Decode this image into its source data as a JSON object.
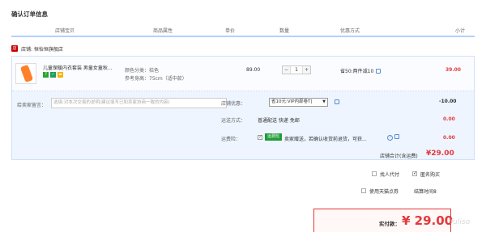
{
  "page": {
    "title": "确认订单信息"
  },
  "columns": [
    "店铺宝贝",
    "商品属性",
    "单价",
    "数量",
    "优惠方式",
    "小计"
  ],
  "shop": {
    "label": "店铺: 恒怡恒旗舰店"
  },
  "item": {
    "title": "儿童保暖内衣套装 男童女童秋...",
    "color": "颜色分类：桔色",
    "height": "参考身高：75cm（适中款）",
    "price": "89.00",
    "quantity": "1",
    "promo": "省50:两件减10",
    "subtotal": "39.00"
  },
  "message": {
    "label": "给卖家留言：",
    "placeholder": "选填:对本次交易的说明(建议填写已和卖家协商一致的内容)"
  },
  "shop_promo": {
    "label": "店铺优惠：",
    "selected": "省10元:VIP内部卷T]",
    "value": "-10.00"
  },
  "shipping": {
    "label": "运送方式：",
    "text": "普通配送 快递 免邮",
    "value": "0.00"
  },
  "insurance": {
    "label": "运费险：",
    "tag": "运费险",
    "text": "卖家赠送，若确认收货前退货，可获...",
    "value": "0.00"
  },
  "shop_total": {
    "label": "店铺合计(含运费)",
    "value": "¥29.00"
  },
  "options": {
    "proxy_pay": "找人代付",
    "anonymous": "匿名购买",
    "tmall_points": "使用天猫点券",
    "settle_time": "结算时间8"
  },
  "payment": {
    "label": "实付款：",
    "currency": "¥",
    "amount": "29.00"
  },
  "watermark": "fuliso",
  "colors": {
    "accent_red": "#e4393c",
    "border_blue": "#b2d1ff",
    "panel_bg": "#eef5ff"
  }
}
